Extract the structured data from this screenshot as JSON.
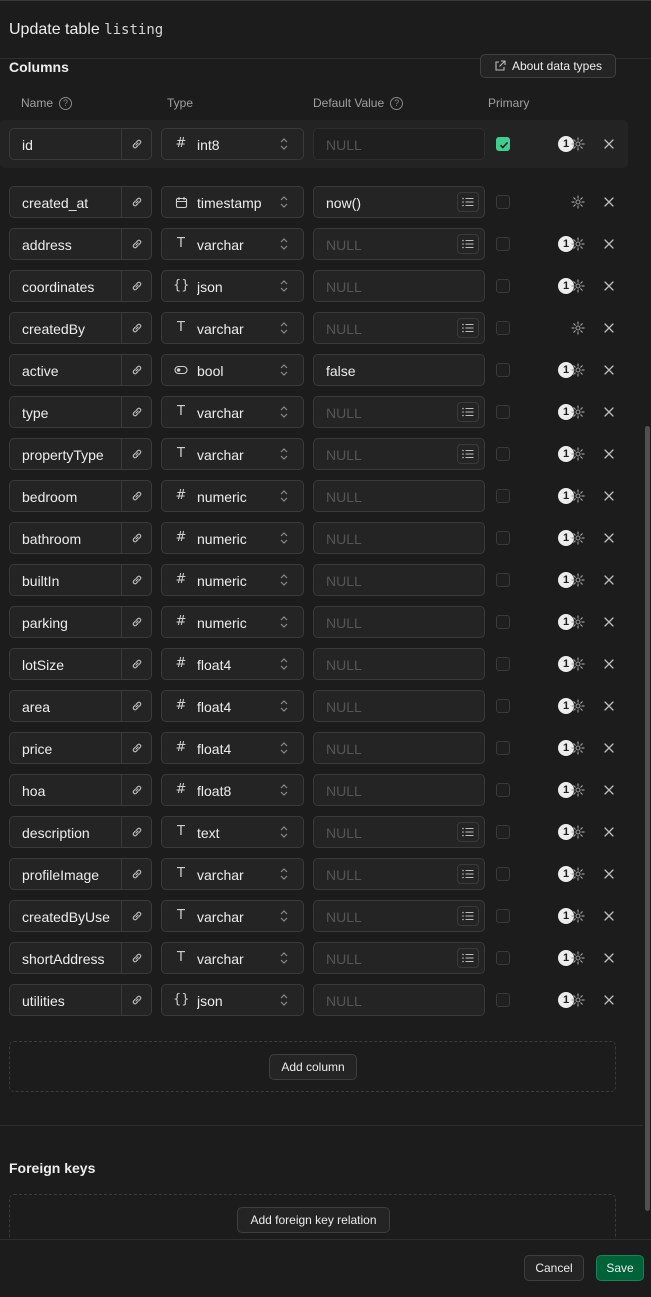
{
  "header": {
    "title_prefix": "Update table",
    "table_name": "listing"
  },
  "columns_section": {
    "title": "Columns",
    "about_label": "About data types",
    "headers": {
      "name": "Name",
      "type": "Type",
      "default": "Default Value",
      "primary": "Primary"
    },
    "add_column_label": "Add column"
  },
  "columns": [
    {
      "name": "id",
      "type": "int8",
      "icon": "#",
      "default": "NULL",
      "default_is_placeholder": true,
      "has_list_button": false,
      "primary": true,
      "badge": "1"
    },
    {
      "name": "created_at",
      "type": "timestamptz",
      "icon": "calendar-icon",
      "default": "now()",
      "default_is_placeholder": false,
      "has_list_button": true,
      "primary": false,
      "badge": ""
    },
    {
      "name": "address",
      "type": "varchar",
      "icon": "T",
      "default": "NULL",
      "default_is_placeholder": true,
      "has_list_button": true,
      "primary": false,
      "badge": "1"
    },
    {
      "name": "coordinates",
      "type": "json",
      "icon": "{}",
      "default": "NULL",
      "default_is_placeholder": true,
      "has_list_button": false,
      "primary": false,
      "badge": "1"
    },
    {
      "name": "createdBy",
      "type": "varchar",
      "icon": "T",
      "default": "NULL",
      "default_is_placeholder": true,
      "has_list_button": true,
      "primary": false,
      "badge": ""
    },
    {
      "name": "active",
      "type": "bool",
      "icon": "toggle-icon",
      "default": "false",
      "default_is_placeholder": false,
      "has_list_button": false,
      "primary": false,
      "badge": "1"
    },
    {
      "name": "type",
      "type": "varchar",
      "icon": "T",
      "default": "NULL",
      "default_is_placeholder": true,
      "has_list_button": true,
      "primary": false,
      "badge": "1"
    },
    {
      "name": "propertyType",
      "type": "varchar",
      "icon": "T",
      "default": "NULL",
      "default_is_placeholder": true,
      "has_list_button": true,
      "primary": false,
      "badge": "1"
    },
    {
      "name": "bedroom",
      "type": "numeric",
      "icon": "#",
      "default": "NULL",
      "default_is_placeholder": true,
      "has_list_button": false,
      "primary": false,
      "badge": "1"
    },
    {
      "name": "bathroom",
      "type": "numeric",
      "icon": "#",
      "default": "NULL",
      "default_is_placeholder": true,
      "has_list_button": false,
      "primary": false,
      "badge": "1"
    },
    {
      "name": "builtIn",
      "type": "numeric",
      "icon": "#",
      "default": "NULL",
      "default_is_placeholder": true,
      "has_list_button": false,
      "primary": false,
      "badge": "1"
    },
    {
      "name": "parking",
      "type": "numeric",
      "icon": "#",
      "default": "NULL",
      "default_is_placeholder": true,
      "has_list_button": false,
      "primary": false,
      "badge": "1"
    },
    {
      "name": "lotSize",
      "type": "float4",
      "icon": "#",
      "default": "NULL",
      "default_is_placeholder": true,
      "has_list_button": false,
      "primary": false,
      "badge": "1"
    },
    {
      "name": "area",
      "type": "float4",
      "icon": "#",
      "default": "NULL",
      "default_is_placeholder": true,
      "has_list_button": false,
      "primary": false,
      "badge": "1"
    },
    {
      "name": "price",
      "type": "float4",
      "icon": "#",
      "default": "NULL",
      "default_is_placeholder": true,
      "has_list_button": false,
      "primary": false,
      "badge": "1"
    },
    {
      "name": "hoa",
      "type": "float8",
      "icon": "#",
      "default": "NULL",
      "default_is_placeholder": true,
      "has_list_button": false,
      "primary": false,
      "badge": "1"
    },
    {
      "name": "description",
      "type": "text",
      "icon": "T",
      "default": "NULL",
      "default_is_placeholder": true,
      "has_list_button": true,
      "primary": false,
      "badge": "1"
    },
    {
      "name": "profileImage",
      "type": "varchar",
      "icon": "T",
      "default": "NULL",
      "default_is_placeholder": true,
      "has_list_button": true,
      "primary": false,
      "badge": "1"
    },
    {
      "name": "createdByUse",
      "type": "varchar",
      "icon": "T",
      "default": "NULL",
      "default_is_placeholder": true,
      "has_list_button": true,
      "primary": false,
      "badge": "1"
    },
    {
      "name": "shortAddress",
      "type": "varchar",
      "icon": "T",
      "default": "NULL",
      "default_is_placeholder": true,
      "has_list_button": true,
      "primary": false,
      "badge": "1"
    },
    {
      "name": "utilities",
      "type": "json",
      "icon": "{}",
      "default": "NULL",
      "default_is_placeholder": true,
      "has_list_button": false,
      "primary": false,
      "badge": "1"
    }
  ],
  "foreign_keys": {
    "title": "Foreign keys",
    "add_label": "Add foreign key relation"
  },
  "footer": {
    "cancel_label": "Cancel",
    "save_label": "Save"
  },
  "colors": {
    "background": "#1c1c1c",
    "accent": "#3ecf8e",
    "save": "#006239"
  }
}
